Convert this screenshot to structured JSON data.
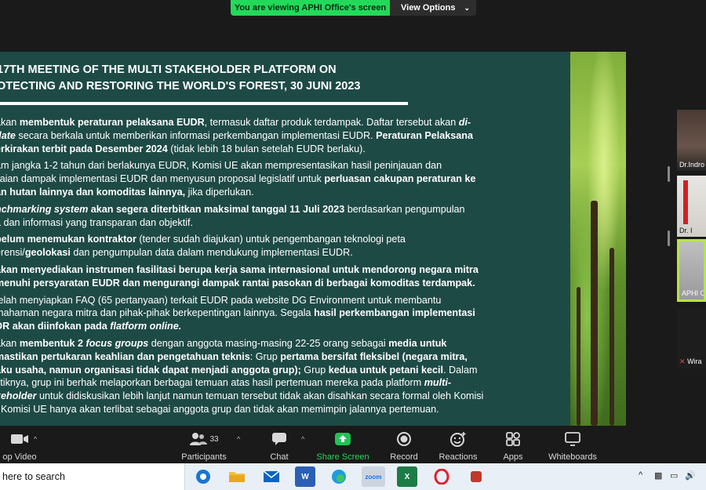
{
  "banner": {
    "status": "You are viewing APHI Office's screen",
    "options": "View Options"
  },
  "slide": {
    "title_lines": [
      "17TH MEETING OF THE MULTI STAKEHOLDER PLATFORM ON",
      "OTECTING AND RESTORING THE WORLD'S FOREST, 30 JUNI 2023"
    ],
    "paragraphs": [
      "akan <b>membentuk peraturan pelaksana EUDR</b>, termasuk daftar produk terdampak. Daftar tersebut akan <b><i>di-</i></b><br><b><i>date</i></b> secara berkala untuk memberikan informasi perkembangan implementasi EUDR. <b>Peraturan Pelaksana</b><br><b>erkirakan terbit pada Desember 2024</b> (tidak lebih 18 bulan setelah EUDR berlaku).",
      "am jangka 1-2 tahun dari berlakunya EUDR, Komisi UE akan mempresentasikan hasil peninjauan dan<br>ilaian dampak implementasi EUDR dan menyusun proposal legislatif untuk <b>perluasan cakupan peraturan ke</b><br><b>an hutan lainnya dan komoditas lainnya,</b> jika diperlukan.",
      "<b><i>nchmarking system</i> akan segera diterbitkan maksimal tanggal 11 Juli 2023</b> berdasarkan pengumpulan<br>a dan informasi yang transparan dan objektif.",
      "<b>belum menemukan kontraktor</b> (tender sudah diajukan) untuk pengembangan teknologi peta<br>erensi/<b>geolokasi</b> dan pengumpulan data dalam mendukung implementasi EUDR.",
      "<b>akan menyediakan instrumen fasilitasi berupa kerja sama internasional untuk mendorong negara mitra</b><br><b>menuhi persyaratan EUDR dan mengurangi dampak rantai pasokan di berbagai komoditas terdampak.</b>",
      "telah menyiapkan FAQ (65 pertanyaan) terkait EUDR pada website DG Environment untuk membantu<br>mahaman negara mitra dan pihak-pihak berkepentingan lainnya. Segala <b>hasil perkembangan implementasi</b><br><b>DR akan diinfokan pada <i>flatform online.</i></b>",
      "akan <b>membentuk 2 <i>focus groups</i></b> dengan anggota masing-masing 22-25 orang sebagai <b>media untuk</b><br><b>mastikan pertukaran keahlian dan pengetahuan teknis</b>: Grup <b>pertama bersifat fleksibel (negara mitra,</b><br><b>aku usaha, namun organisasi tidak dapat menjadi anggota grup);</b> Grup <b>kedua untuk petani kecil</b>. Dalam<br>ktiknya, grup ini berhak melaporkan berbagai temuan atas hasil pertemuan mereka pada platform <b><i>multi-</i></b><br><b><i>keholder</i></b> untuk didiskusikan lebih lanjut namun temuan tersebut tidak akan disahkan secara formal oleh Komisi<br>. Komisi UE hanya akan terlibat sebagai anggota grup dan tidak akan memimpin jalannya pertemuan."
    ]
  },
  "gallery": {
    "tiles": [
      {
        "name": "Dr.Indro"
      },
      {
        "name": "Dr. I"
      },
      {
        "name": "APHI O"
      },
      {
        "name": "Wira"
      }
    ]
  },
  "toolbar": {
    "items": [
      {
        "label": "op Video",
        "icon": "video-camera-icon"
      },
      {
        "label": "Participants",
        "count": "33",
        "icon": "participants-icon"
      },
      {
        "label": "Chat",
        "icon": "chat-icon"
      },
      {
        "label": "Share Screen",
        "icon": "share-screen-icon"
      },
      {
        "label": "Record",
        "icon": "record-icon"
      },
      {
        "label": "Reactions",
        "icon": "reactions-icon"
      },
      {
        "label": "Apps",
        "icon": "apps-icon"
      },
      {
        "label": "Whiteboards",
        "icon": "whiteboard-icon"
      }
    ]
  },
  "taskbar": {
    "search_text": "here to search",
    "apps": [
      {
        "name": "chrome",
        "label": ""
      },
      {
        "name": "file-explorer",
        "label": ""
      },
      {
        "name": "mail",
        "label": ""
      },
      {
        "name": "word",
        "label": "W"
      },
      {
        "name": "edge",
        "label": ""
      },
      {
        "name": "zoom",
        "label": "zoom"
      },
      {
        "name": "excel",
        "label": "X"
      },
      {
        "name": "opera",
        "label": "O"
      },
      {
        "name": "app",
        "label": ""
      }
    ],
    "tray": {
      "chevron": "^"
    }
  },
  "colors": {
    "accent_green": "#23d959",
    "slide_bg": "#1e4a46",
    "active_tile_border": "#b8e34a"
  }
}
